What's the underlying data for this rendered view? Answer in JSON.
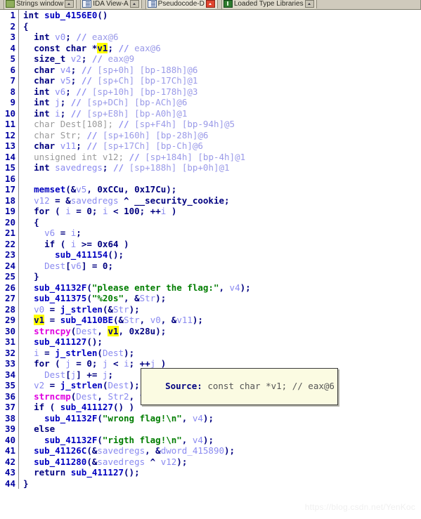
{
  "window": {
    "title": "Pseudocode-D",
    "watermark": "https://blog.csdn.net/YenKoc"
  },
  "tabs": [
    {
      "label": "Strings window",
      "icon": "strings-icon",
      "button": "maximize-icon",
      "active": false
    },
    {
      "label": "IDA View-A",
      "icon": "document-icon",
      "button": "maximize-icon",
      "active": false
    },
    {
      "label": "Pseudocode-D",
      "icon": "document-icon",
      "button": "close-icon",
      "active": true
    },
    {
      "label": "Loaded Type Libraries",
      "icon": "library-icon",
      "button": "maximize-icon",
      "active": false
    }
  ],
  "tooltip": {
    "visible": true,
    "label": "Source:",
    "text": " const char *v1; // eax@6"
  },
  "colors": {
    "keyword": "#000080",
    "function": "#0000c0",
    "local_var": "#8a8af0",
    "string": "#007d00",
    "library_func": "#e000e0",
    "comment": "#9a9ae8",
    "highlight": "#ffff00",
    "line_number": "#0000a0",
    "tab_bar": "#d6d2c2",
    "tooltip_bg": "#fbfbe2",
    "background": "#ffffff"
  },
  "code": {
    "first_line": 1,
    "last_line": 44,
    "highlighted_token": "v1",
    "lines": [
      {
        "n": 1,
        "text": "int sub_4156E0()"
      },
      {
        "n": 2,
        "text": "{"
      },
      {
        "n": 3,
        "text": "  int v0; // eax@6"
      },
      {
        "n": 4,
        "text": "  const char *v1; // eax@6"
      },
      {
        "n": 5,
        "text": "  size_t v2; // eax@9"
      },
      {
        "n": 6,
        "text": "  char v4; // [sp+0h] [bp-188h]@6"
      },
      {
        "n": 7,
        "text": "  char v5; // [sp+Ch] [bp-17Ch]@1"
      },
      {
        "n": 8,
        "text": "  int v6; // [sp+10h] [bp-178h]@3"
      },
      {
        "n": 9,
        "text": "  int j; // [sp+DCh] [bp-ACh]@6"
      },
      {
        "n": 10,
        "text": "  int i; // [sp+E8h] [bp-A0h]@1"
      },
      {
        "n": 11,
        "text": "  char Dest[108]; // [sp+F4h] [bp-94h]@5"
      },
      {
        "n": 12,
        "text": "  char Str; // [sp+160h] [bp-28h]@6"
      },
      {
        "n": 13,
        "text": "  char v11; // [sp+17Ch] [bp-Ch]@6"
      },
      {
        "n": 14,
        "text": "  unsigned int v12; // [sp+184h] [bp-4h]@1"
      },
      {
        "n": 15,
        "text": "  int savedregs; // [sp+188h] [bp+0h]@1"
      },
      {
        "n": 16,
        "text": ""
      },
      {
        "n": 17,
        "text": "  memset(&v5, 0xCCu, 0x17Cu);"
      },
      {
        "n": 18,
        "text": "  v12 = &savedregs ^ __security_cookie;"
      },
      {
        "n": 19,
        "text": "  for ( i = 0; i < 100; ++i )"
      },
      {
        "n": 20,
        "text": "  {"
      },
      {
        "n": 21,
        "text": "    v6 = i;"
      },
      {
        "n": 22,
        "text": "    if ( i >= 0x64 )"
      },
      {
        "n": 23,
        "text": "      sub_411154();"
      },
      {
        "n": 24,
        "text": "    Dest[v6] = 0;"
      },
      {
        "n": 25,
        "text": "  }"
      },
      {
        "n": 26,
        "text": "  sub_41132F(\"please enter the flag:\", v4);"
      },
      {
        "n": 27,
        "text": "  sub_411375(\"%20s\", &Str);"
      },
      {
        "n": 28,
        "text": "  v0 = j_strlen(&Str);"
      },
      {
        "n": 29,
        "text": "  v1 = sub_4110BE(&Str, v0, &v11);"
      },
      {
        "n": 30,
        "text": "  strncpy(Dest, v1, 0x28u);"
      },
      {
        "n": 31,
        "text": "  sub_411127();"
      },
      {
        "n": 32,
        "text": "  i = j_strlen(Dest);"
      },
      {
        "n": 33,
        "text": "  for ( j = 0; j < i; ++j )"
      },
      {
        "n": 34,
        "text": "    Dest[j] += j;"
      },
      {
        "n": 35,
        "text": "  v2 = j_strlen(Dest);"
      },
      {
        "n": 36,
        "text": "  strncmp(Dest, Str2, v2);"
      },
      {
        "n": 37,
        "text": "  if ( sub_411127() )"
      },
      {
        "n": 38,
        "text": "    sub_41132F(\"wrong flag!\\n\", v4);"
      },
      {
        "n": 39,
        "text": "  else"
      },
      {
        "n": 40,
        "text": "    sub_41132F(\"rigth flag!\\n\", v4);"
      },
      {
        "n": 41,
        "text": "  sub_41126C(&savedregs, &dword_415890);"
      },
      {
        "n": 42,
        "text": "  sub_411280(&savedregs ^ v12);"
      },
      {
        "n": 43,
        "text": "  return sub_411127();"
      },
      {
        "n": 44,
        "text": "}"
      }
    ],
    "rendered": [
      {
        "n": 1,
        "html": "<span class='kw'>int </span><span class='fn'>sub_4156E0</span><span class='punct'>()</span>"
      },
      {
        "n": 2,
        "html": "<span class='punct'>{</span>"
      },
      {
        "n": 3,
        "html": "  <span class='kw'>int</span> <span class='var'>v0</span><span class='punct'>;</span> <span class='cmt'>//</span> <span class='cmtx'>eax@6</span>"
      },
      {
        "n": 4,
        "html": "  <span class='kw'>const char</span> <span class='punct'>*</span><span class='hl'>v1</span><span class='punct'>;</span> <span class='cmt'>//</span> <span class='cmtx'>eax@6</span>"
      },
      {
        "n": 5,
        "html": "  <span class='kw'>size_t</span> <span class='var'>v2</span><span class='punct'>;</span> <span class='cmt'>//</span> <span class='cmtx'>eax@9</span>"
      },
      {
        "n": 6,
        "html": "  <span class='kw'>char</span> <span class='var'>v4</span><span class='punct'>;</span> <span class='cmt'>//</span> <span class='cmtx'>[sp+0h] [bp-188h]@6</span>"
      },
      {
        "n": 7,
        "html": "  <span class='kw'>char</span> <span class='var'>v5</span><span class='punct'>;</span> <span class='cmt'>//</span> <span class='cmtx'>[sp+Ch] [bp-17Ch]@1</span>"
      },
      {
        "n": 8,
        "html": "  <span class='kw'>int</span> <span class='var'>v6</span><span class='punct'>;</span> <span class='cmt'>//</span> <span class='cmtx'>[sp+10h] [bp-178h]@3</span>"
      },
      {
        "n": 9,
        "html": "  <span class='kw'>int</span> <span class='var'>j</span><span class='punct'>;</span> <span class='cmt'>//</span> <span class='cmtx'>[sp+DCh] [bp-ACh]@6</span>"
      },
      {
        "n": 10,
        "html": "  <span class='kw'>int</span> <span class='var'>i</span><span class='punct'>;</span> <span class='cmt'>//</span> <span class='cmtx'>[sp+E8h] [bp-A0h]@1</span>"
      },
      {
        "n": 11,
        "html": "  <span class='dim'>char</span> <span class='dim'>Dest[108]</span><span class='dim'>;</span> <span class='cmt'>//</span> <span class='cmtx'>[sp+F4h] [bp-94h]@5</span>"
      },
      {
        "n": 12,
        "html": "  <span class='dim'>char</span> <span class='dim'>Str</span><span class='dim'>;</span> <span class='cmt'>//</span> <span class='cmtx'>[sp+160h] [bp-28h]@6</span>"
      },
      {
        "n": 13,
        "html": "  <span class='kw'>char</span> <span class='var'>v11</span><span class='punct'>;</span> <span class='cmt'>//</span> <span class='cmtx'>[sp+17Ch] [bp-Ch]@6</span>"
      },
      {
        "n": 14,
        "html": "  <span class='dim'>unsigned int</span> <span class='dim'>v12</span><span class='dim'>;</span> <span class='cmt'>//</span> <span class='cmtx'>[sp+184h] [bp-4h]@1</span>"
      },
      {
        "n": 15,
        "html": "  <span class='kw'>int</span> <span class='var'>savedregs</span><span class='punct'>;</span> <span class='cmt'>//</span> <span class='cmtx'>[sp+188h] [bp+0h]@1</span>"
      },
      {
        "n": 16,
        "html": ""
      },
      {
        "n": 17,
        "html": "  <span class='fn'>memset</span><span class='punct'>(&amp;</span><span class='var'>v5</span><span class='punct'>, </span><span class='num'>0xCCu</span><span class='punct'>, </span><span class='num'>0x17Cu</span><span class='punct'>);</span>"
      },
      {
        "n": 18,
        "html": "  <span class='var'>v12</span> <span class='punct'>= &amp;</span><span class='var'>savedregs</span> <span class='punct'>^ __security_cookie;</span>"
      },
      {
        "n": 19,
        "html": "  <span class='kw'>for</span> <span class='punct'>( </span><span class='var'>i</span> <span class='punct'>= </span><span class='num'>0</span><span class='punct'>; </span><span class='var'>i</span> <span class='punct'>&lt; </span><span class='num'>100</span><span class='punct'>; ++</span><span class='var'>i</span> <span class='punct'>)</span>"
      },
      {
        "n": 20,
        "html": "  <span class='punct'>{</span>"
      },
      {
        "n": 21,
        "html": "    <span class='var'>v6</span> <span class='punct'>= </span><span class='var'>i</span><span class='punct'>;</span>"
      },
      {
        "n": 22,
        "html": "    <span class='kw'>if</span> <span class='punct'>( </span><span class='var'>i</span> <span class='punct'>&gt;= </span><span class='num'>0x64</span> <span class='punct'>)</span>"
      },
      {
        "n": 23,
        "html": "      <span class='fn'>sub_411154</span><span class='punct'>();</span>"
      },
      {
        "n": 24,
        "html": "    <span class='var'>Dest</span><span class='punct'>[</span><span class='var'>v6</span><span class='punct'>] = </span><span class='num'>0</span><span class='punct'>;</span>"
      },
      {
        "n": 25,
        "html": "  <span class='punct'>}</span>"
      },
      {
        "n": 26,
        "html": "  <span class='fn'>sub_41132F</span><span class='punct'>(</span><span class='str'>\"please enter the flag:\"</span><span class='punct'>, </span><span class='var'>v4</span><span class='punct'>);</span>"
      },
      {
        "n": 27,
        "html": "  <span class='fn'>sub_411375</span><span class='punct'>(</span><span class='str'>\"%20s\"</span><span class='punct'>, &amp;</span><span class='var'>Str</span><span class='punct'>);</span>"
      },
      {
        "n": 28,
        "html": "  <span class='var'>v0</span> <span class='punct'>= </span><span class='fn'>j_strlen</span><span class='punct'>(&amp;</span><span class='var'>Str</span><span class='punct'>);</span>"
      },
      {
        "n": 29,
        "html": "  <span class='hl'>v1</span> <span class='punct'>= </span><span class='fn'>sub_4110BE</span><span class='punct'>(&amp;</span><span class='var'>Str</span><span class='punct'>, </span><span class='var'>v0</span><span class='punct'>, &amp;</span><span class='var'>v11</span><span class='punct'>);</span>"
      },
      {
        "n": 30,
        "html": "  <span class='lib'>strncpy</span><span class='punct'>(</span><span class='var'>Dest</span><span class='punct'>, </span><span class='hl'>v1</span><span class='punct'>, </span><span class='num'>0x28u</span><span class='punct'>);</span>"
      },
      {
        "n": 31,
        "html": "  <span class='fn'>sub_411127</span><span class='punct'>();</span>"
      },
      {
        "n": 32,
        "html": "  <span class='var'>i</span> <span class='punct'>= </span><span class='fn'>j_strlen</span><span class='punct'>(</span><span class='var'>Dest</span><span class='punct'>);</span>"
      },
      {
        "n": 33,
        "html": "  <span class='kw'>for</span> <span class='punct'>( </span><span class='var'>j</span> <span class='punct'>= </span><span class='num'>0</span><span class='punct'>; </span><span class='var'>j</span> <span class='punct'>&lt; </span><span class='var'>i</span><span class='punct'>; ++</span><span class='var'>j</span> <span class='punct'>)</span>"
      },
      {
        "n": 34,
        "html": "    <span class='var'>Dest</span><span class='punct'>[</span><span class='var'>j</span><span class='punct'>] += </span><span class='var'>j</span><span class='punct'>;</span>"
      },
      {
        "n": 35,
        "html": "  <span class='var'>v2</span> <span class='punct'>= </span><span class='fn'>j_strlen</span><span class='punct'>(</span><span class='var'>Dest</span><span class='punct'>);</span>"
      },
      {
        "n": 36,
        "html": "  <span class='lib'>strncmp</span><span class='punct'>(</span><span class='var'>Dest</span><span class='punct'>, </span><span class='var'>Str2</span><span class='punct'>, </span><span class='var'>v2</span><span class='punct'>);</span>"
      },
      {
        "n": 37,
        "html": "  <span class='kw'>if</span> <span class='punct'>( </span><span class='fn'>sub_411127</span><span class='punct'>() )</span>"
      },
      {
        "n": 38,
        "html": "    <span class='fn'>sub_41132F</span><span class='punct'>(</span><span class='str'>\"wrong flag!\\n\"</span><span class='punct'>, </span><span class='var'>v4</span><span class='punct'>);</span>"
      },
      {
        "n": 39,
        "html": "  <span class='kw'>else</span>"
      },
      {
        "n": 40,
        "html": "    <span class='fn'>sub_41132F</span><span class='punct'>(</span><span class='str'>\"rigth flag!\\n\"</span><span class='punct'>, </span><span class='var'>v4</span><span class='punct'>);</span>"
      },
      {
        "n": 41,
        "html": "  <span class='fn'>sub_41126C</span><span class='punct'>(&amp;</span><span class='var'>savedregs</span><span class='punct'>, &amp;</span><span class='var'>dword_415890</span><span class='punct'>);</span>"
      },
      {
        "n": 42,
        "html": "  <span class='fn'>sub_411280</span><span class='punct'>(&amp;</span><span class='var'>savedregs</span> <span class='punct'>^ </span><span class='var'>v12</span><span class='punct'>);</span>"
      },
      {
        "n": 43,
        "html": "  <span class='kw'>return</span> <span class='fn'>sub_411127</span><span class='punct'>();</span>"
      },
      {
        "n": 44,
        "html": "<span class='punct'>}</span>"
      }
    ]
  }
}
